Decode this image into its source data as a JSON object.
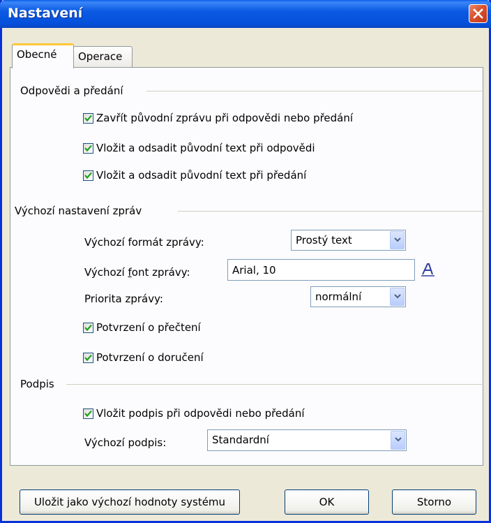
{
  "window": {
    "title": "Nastavení"
  },
  "tabs": [
    {
      "label": "Obecné"
    },
    {
      "label": "Operace"
    }
  ],
  "replies": {
    "heading": "Odpovědi a předání",
    "options": [
      {
        "label": "Zavřít původní zprávu při odpovědi nebo předání",
        "checked": true
      },
      {
        "label": "Vložit a odsadit původní text při odpovědi",
        "checked": true
      },
      {
        "label": "Vložit a odsadit původní text při předání",
        "checked": true
      }
    ]
  },
  "defaults": {
    "heading": "Výchozí nastavení zpráv",
    "format_label": "Výchozí formát zprávy:",
    "format_value": "Prostý text",
    "font_label_pre": "Výchozí ",
    "font_label_u": "f",
    "font_label_post": "ont zprávy:",
    "font_value": "Arial, 10",
    "font_icon": "font-picker-icon",
    "priority_label": "Priorita zprávy:",
    "priority_value": "normální",
    "read_receipt": "Potvrzení o přečtení",
    "delivery_receipt": "Potvrzení o doručení"
  },
  "signature": {
    "heading": "Podpis",
    "insert_label": "Vložit podpis při odpovědi nebo předání",
    "default_label": "Výchozí podpis:",
    "default_value": "Standardní"
  },
  "buttons": {
    "save_defaults": "Uložit jako výchozí hodnoty systému",
    "ok": "OK",
    "cancel": "Storno"
  },
  "colors": {
    "titlebar": "#0a5ee8",
    "check": "#21a121",
    "tab_highlight": "#ffc73c",
    "close": "#d9532d"
  }
}
